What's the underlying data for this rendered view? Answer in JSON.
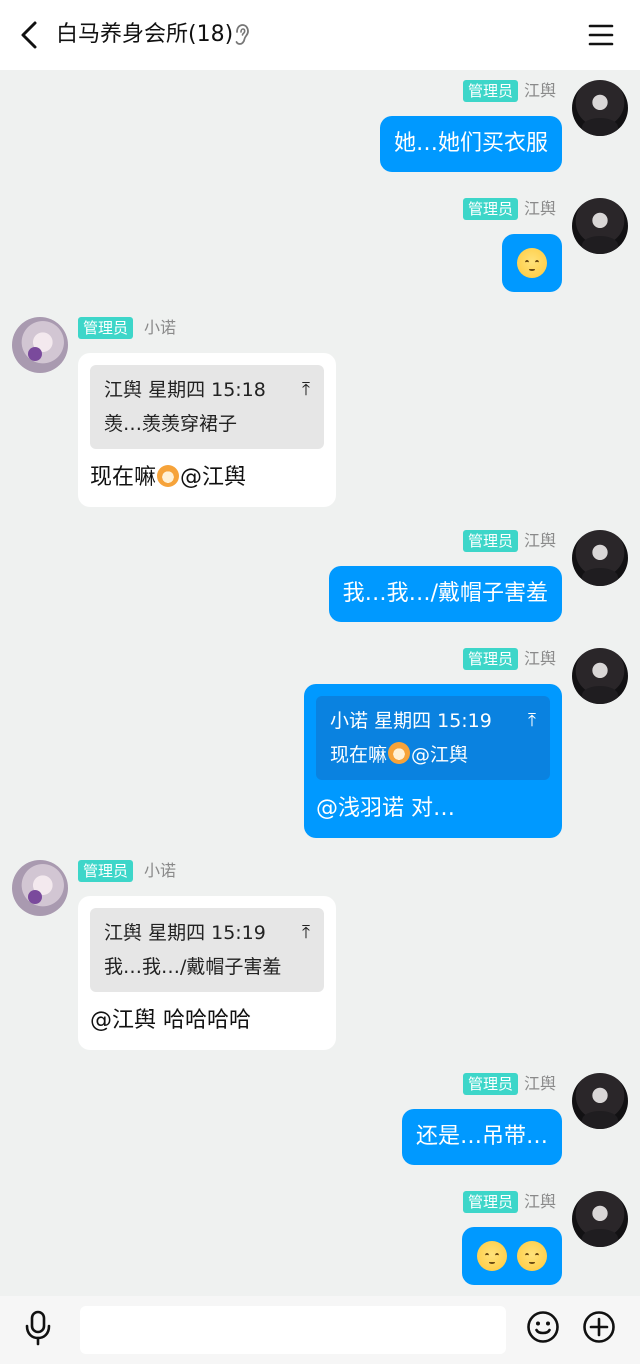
{
  "header": {
    "title": "白马养身会所(18)",
    "back_icon": "chevron-left-icon",
    "ear_icon": "ear-icon",
    "menu_icon": "menu-icon"
  },
  "messages": [
    {
      "side": "me",
      "role": "管理员",
      "sender": "江舆",
      "text": "她…她们买衣服"
    },
    {
      "side": "me",
      "role": "管理员",
      "sender": "江舆",
      "emoji": "pleading-face"
    },
    {
      "side": "other",
      "role": "管理员",
      "sender": "小诺",
      "quote": {
        "author": "江舆",
        "time": "星期四 15:18",
        "text": "羡…羡羡穿裙子"
      },
      "text_before": "现在嘛",
      "text_after": "@江舆"
    },
    {
      "side": "me",
      "role": "管理员",
      "sender": "江舆",
      "text": "我…我…/戴帽子害羞"
    },
    {
      "side": "me",
      "role": "管理员",
      "sender": "江舆",
      "quote": {
        "author": "小诺",
        "time": "星期四 15:19",
        "text_before": "现在嘛",
        "text_after": "@江舆"
      },
      "text": "@浅羽诺 对…"
    },
    {
      "side": "other",
      "role": "管理员",
      "sender": "小诺",
      "quote": {
        "author": "江舆",
        "time": "星期四 15:19",
        "text": "我…我…/戴帽子害羞"
      },
      "text": "@江舆 哈哈哈哈"
    },
    {
      "side": "me",
      "role": "管理员",
      "sender": "江舆",
      "text": "还是…吊带…"
    },
    {
      "side": "me",
      "role": "管理员",
      "sender": "江舆",
      "emoji": "pleading-face x2"
    }
  ],
  "quote_arrow": "⤒",
  "input_bar": {
    "placeholder": "",
    "mic_icon": "microphone-icon",
    "emoji_icon": "smiley-icon",
    "plus_icon": "plus-circle-icon"
  },
  "colors": {
    "my_bubble": "#0099ff",
    "badge": "#3dd6c9",
    "background": "#eff1f0"
  }
}
